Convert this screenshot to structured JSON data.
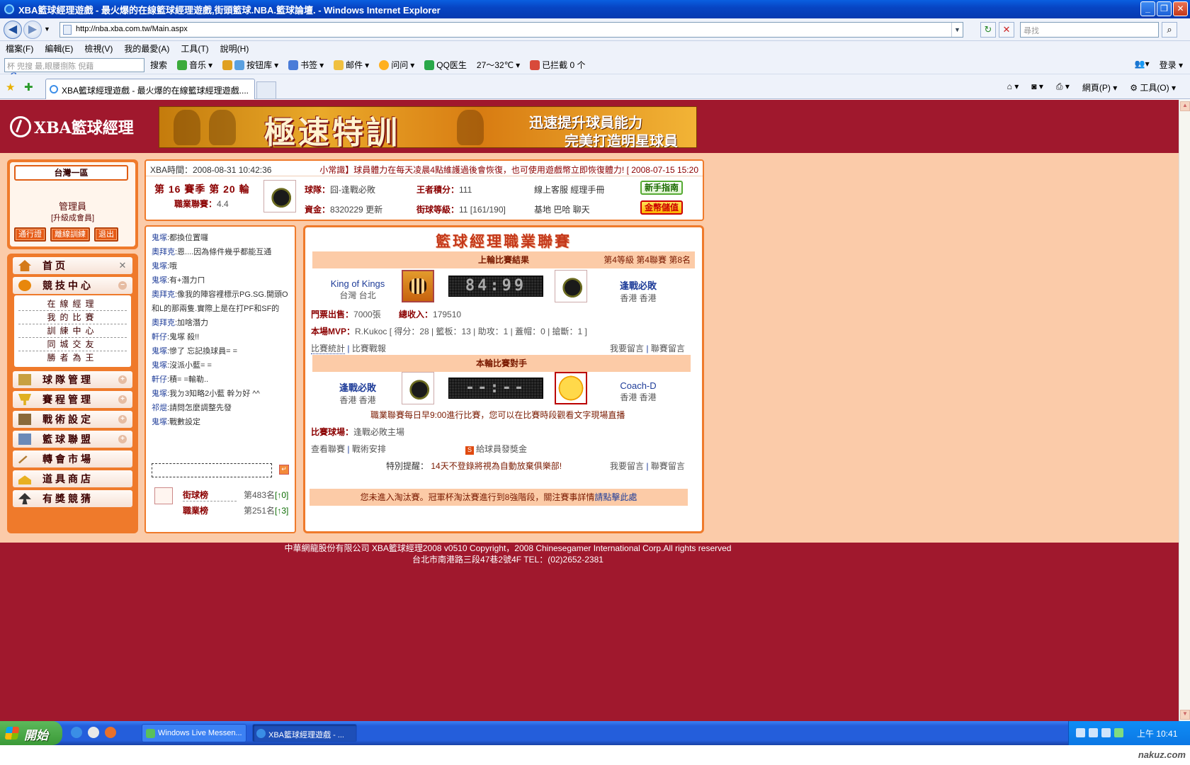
{
  "window": {
    "title": "XBA籃球經理遊戲 - 最火爆的在線籃球經理遊戲,街頭籃球.NBA.籃球論壇. - Windows Internet Explorer"
  },
  "browser": {
    "url": "http://nba.xba.com.tw/Main.aspx",
    "search_placeholder": "尋找",
    "menu": [
      "檔案(F)",
      "編輯(E)",
      "檢視(V)",
      "我的最愛(A)",
      "工具(T)",
      "說明(H)"
    ],
    "soso": {
      "logo": "Soso",
      "combo": "杯  兜搜    最,眼腰捌陈 倪藉",
      "search": "搜索",
      "items": [
        "音乐",
        "按钮库",
        "书签",
        "邮件",
        "问问",
        "QQ医生",
        "27～32℃",
        "已拦截 0 个"
      ],
      "login": "登录"
    },
    "tab_title": "XBA籃球經理遊戲 - 最火爆的在線籃球經理遊戲....",
    "cmd": [
      "網頁(P)",
      "工具(O)"
    ]
  },
  "site": {
    "logo": "XBA籃球經理",
    "banner": {
      "main": "極速特訓",
      "line1": "迅速提升球員能力",
      "line2": "完美打造明星球員"
    },
    "region": "台灣一區",
    "user": {
      "name": "管理員",
      "upgrade": "[升級成會員]",
      "buttons": [
        "通行證",
        "離線訓練",
        "退出"
      ]
    },
    "nav": [
      {
        "label": "首页",
        "expand": "✕"
      },
      {
        "label": "競技中心",
        "expand": "−"
      },
      {
        "label": "球隊管理",
        "expand": "+"
      },
      {
        "label": "賽程管理",
        "expand": "+"
      },
      {
        "label": "戰術設定",
        "expand": "+"
      },
      {
        "label": "籃球聯盟",
        "expand": "+"
      },
      {
        "label": "轉會市場",
        "expand": ""
      },
      {
        "label": "道具商店",
        "expand": ""
      },
      {
        "label": "有獎競猜",
        "expand": ""
      }
    ],
    "sub": [
      "在線經理",
      "我的比賽",
      "訓練中心",
      "同城交友",
      "勝者為王"
    ],
    "info": {
      "time": "XBA時間：2008-08-31 10:42:36",
      "tip": "小常識】球員體力在每天凌晨4點維護過後會恢復，也可使用遊戲幣立即恢復體力! [ 2008-07-15 15:20",
      "season": "第 16 賽季 第 20 輪",
      "league_label": "職業聯賽：",
      "league_val": "4.4",
      "team_label": "球隊：",
      "team_val": "囧-逢戰必敗",
      "fund_label": "資金：",
      "fund_val": "8320229",
      "fund_link": "更新",
      "king_label": "王者積分：",
      "king_val": "111",
      "street_label": "街球等級：",
      "street_val": "11 [161/190]",
      "links1": "線上客服  經理手冊",
      "links2": "基地  巴哈  聊天",
      "btn_guide": "新手指南",
      "btn_pay": "金幣儲值"
    },
    "chat": [
      {
        "u": "鬼塚",
        "t": ":都換位置囉"
      },
      {
        "u": "奧拜克",
        "t": ":恩....因為條件幾乎都能互通"
      },
      {
        "u": "鬼塚",
        "t": ":哦"
      },
      {
        "u": "鬼塚",
        "t": ":有+潛力ㄇ"
      },
      {
        "u": "奧拜克",
        "t": ":像我的陣容裡標示PG.SG.開頭O和L的那兩隻.實際上是在打PF和SF的"
      },
      {
        "u": "奧拜克",
        "t": ":加啥潛力"
      },
      {
        "u": "軒仔",
        "t": ":鬼塚  殺!!"
      },
      {
        "u": "鬼塚",
        "t": ":慘了  忘記換球員= ="
      },
      {
        "u": "鬼塚",
        "t": ":沒派小藍= ="
      },
      {
        "u": "軒仔",
        "t": ":積= =輸勒.."
      },
      {
        "u": "鬼塚",
        "t": ":我ㄉ3知略2小藍  幹ㄉ好  ^^"
      },
      {
        "u": "祁焜",
        "t": ":請問怎麼調整先發"
      },
      {
        "u": "鬼塚",
        "t": ":戰數設定"
      }
    ],
    "rank": [
      {
        "label": "街球榜",
        "val": "第483名",
        "delta": "[↑0]"
      },
      {
        "label": "職業榜",
        "val": "第251名",
        "delta": "[↑3]"
      }
    ],
    "league": {
      "title": "籃球經理職業聯賽",
      "last_header": "上輪比賽結果",
      "last_rank": "第4等級  第4聯賽  第8名",
      "home": {
        "name": "King of Kings",
        "loc": "台灣  台北"
      },
      "away": {
        "name": "逢戰必敗",
        "loc": "香港  香港"
      },
      "score": "84:99",
      "ticket_label": "門票出售：",
      "ticket_val": "7000張",
      "income_label": "總收入：",
      "income_val": "179510",
      "mvp_label": "本場MVP：",
      "mvp_val": "R.Kukoc  [ 得分：28 | 籃板：13 | 助攻：1 | 蓋帽：0 | 搶斷：1 ]",
      "stats_link": "比賽統計",
      "report_link": "比賽戰報",
      "msg_link": "我要留言",
      "league_msg": "聯賽留言",
      "next_header": "本輪比賽對手",
      "next_home": {
        "name": "逢戰必敗",
        "loc": "香港  香港"
      },
      "next_away": {
        "name": "Coach-D",
        "loc": "香港  香港"
      },
      "next_score": "--:--",
      "schedule": "職業聯賽每日早9:00進行比賽，您可以在比賽時段觀看文字現場直播",
      "venue_label": "比賽球場：",
      "venue_val": "逢戰必敗主場",
      "view_league": "查看聯賽",
      "tactics": "戰術安排",
      "bonus": "給球員發獎金",
      "warn_label": "特別提醒：",
      "warn_val": "14天不登錄將視為自動放棄俱樂部!",
      "notice": "您未進入淘汰賽。冠軍杯淘汰賽進行到8強階段，關注賽事詳情",
      "notice_link": "請點擊此處"
    },
    "footer": {
      "line1": "中華網龍股份有限公司  XBA籃球經理2008 v0510      Copyright，2008 Chinesegamer International Corp.All rights reserved",
      "line2": "台北市南港路三段47巷2號4F TEL：(02)2652-2381"
    }
  },
  "taskbar": {
    "start": "開始",
    "tasks": [
      "Windows Live Messen...",
      "XBA籃球經理遊戲 - ..."
    ],
    "clock": "上午 10:41"
  },
  "watermark": "nakuz.com"
}
